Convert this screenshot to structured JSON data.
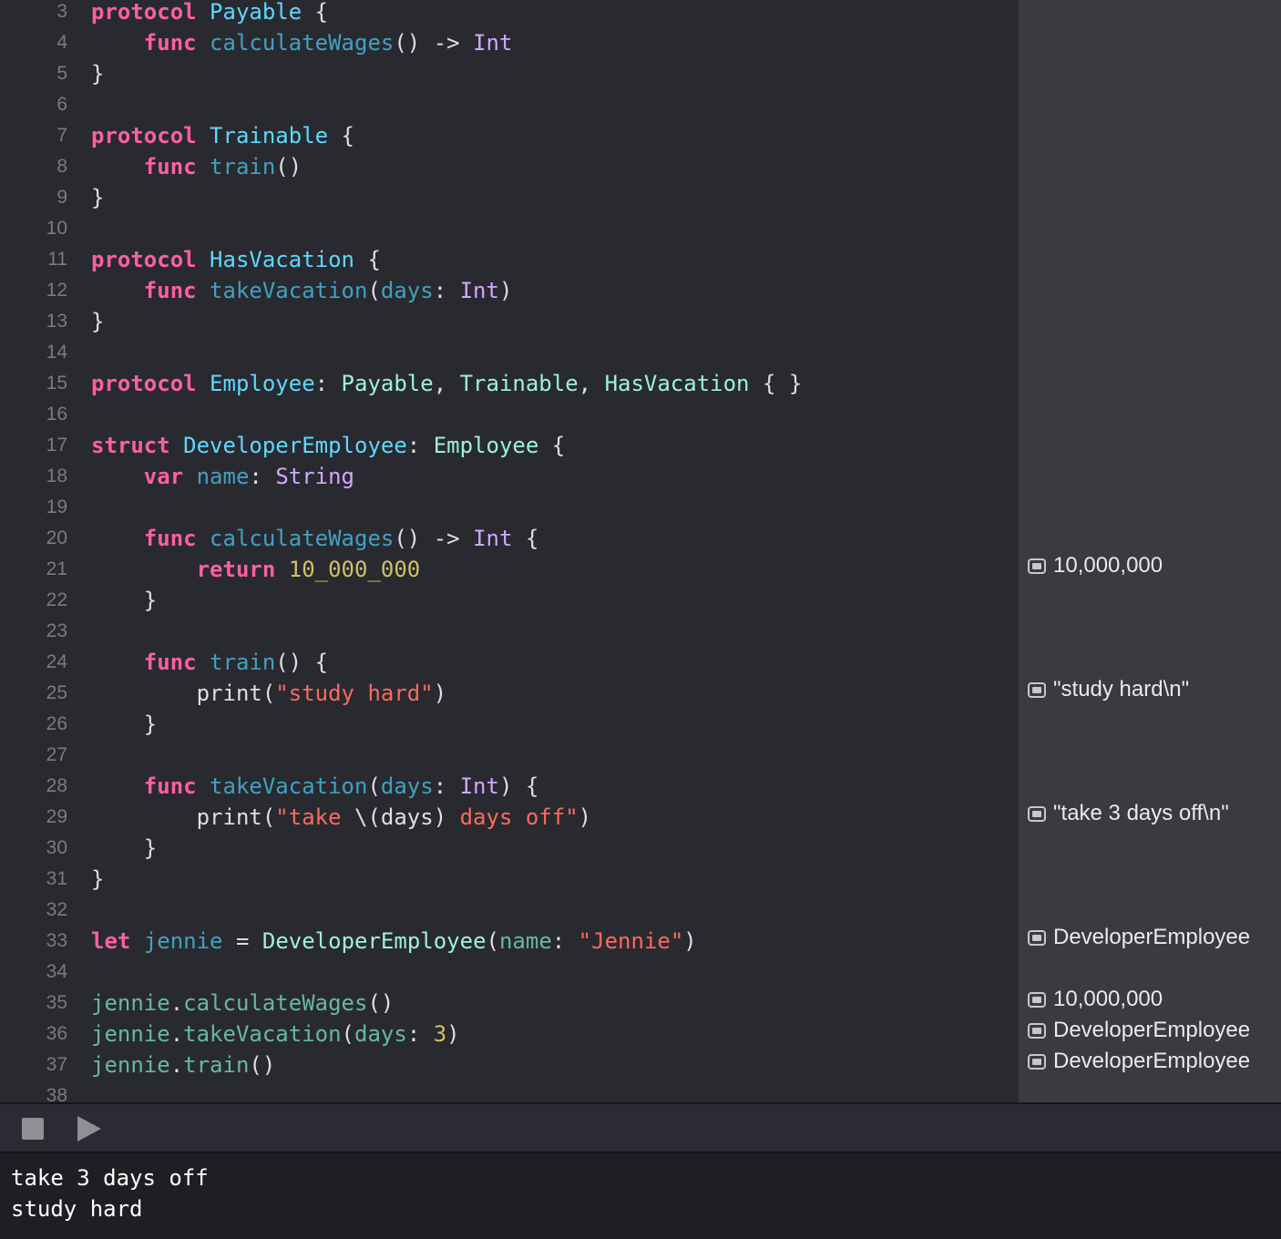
{
  "editor": {
    "line_numbers": [
      "3",
      "4",
      "5",
      "6",
      "7",
      "8",
      "9",
      "10",
      "11",
      "12",
      "13",
      "14",
      "15",
      "16",
      "17",
      "18",
      "19",
      "20",
      "21",
      "22",
      "23",
      "24",
      "25",
      "26",
      "27",
      "28",
      "29",
      "30",
      "31",
      "32",
      "33",
      "34",
      "35",
      "36",
      "37",
      "38"
    ],
    "t": {
      "kw_protocol": "protocol",
      "kw_func": "func",
      "kw_struct": "struct",
      "kw_var": "var",
      "kw_return": "return",
      "kw_let": "let",
      "payable": "Payable",
      "trainable": "Trainable",
      "hasvacation": "HasVacation",
      "employee": "Employee",
      "developer_employee": "DeveloperEmployee",
      "calculate_wages": "calculateWages",
      "train": "train",
      "take_vacation": "takeVacation",
      "days": "days",
      "name": "name",
      "int": "Int",
      "string": "String",
      "print": "print",
      "jennie": "jennie",
      "open_brace": "{",
      "close_brace": "}",
      "empty_parens": "()",
      "arrow": "->",
      "open_paren": "(",
      "close_paren": ")",
      "colon": ":",
      "comma": ",",
      "equals": "=",
      "dot": ".",
      "empty_braces": "{ }",
      "num_wages": "10_000_000",
      "num_days": "3",
      "str_study_hard": "\"study hard\"",
      "str_take": "\"take ",
      "interp": "\\(days)",
      "str_days_off": " days off\"",
      "str_jennie": "\"Jennie\""
    }
  },
  "results": {
    "wages_return": "10,000,000",
    "train_print": "\"study hard\\n\"",
    "vacation_print": "\"take 3 days off\\n\"",
    "jennie_init": "DeveloperEmployee",
    "call_wages": "10,000,000",
    "call_vacation": "DeveloperEmployee",
    "call_train": "DeveloperEmployee"
  },
  "console": {
    "lines": [
      "take 3 days off",
      "study hard"
    ]
  },
  "colors": {
    "background": "#292a30",
    "results_panel": "#3a3a3f",
    "keyword": "#fc5fa3",
    "type_declaration": "#5dd8ff",
    "system_type": "#d0a8ff",
    "project_type": "#9ef1dd",
    "string": "#fc6a5d",
    "number": "#d0bf69"
  }
}
